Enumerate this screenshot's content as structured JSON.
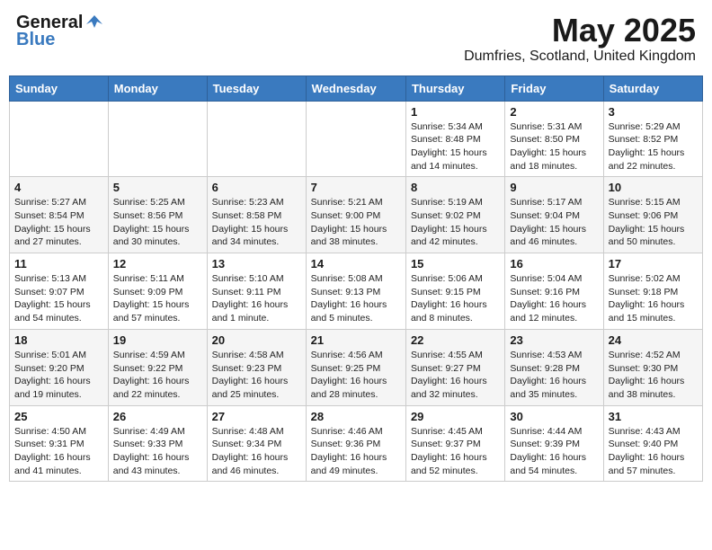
{
  "header": {
    "logo_general": "General",
    "logo_blue": "Blue",
    "month_title": "May 2025",
    "location": "Dumfries, Scotland, United Kingdom"
  },
  "weekdays": [
    "Sunday",
    "Monday",
    "Tuesday",
    "Wednesday",
    "Thursday",
    "Friday",
    "Saturday"
  ],
  "weeks": [
    [
      {
        "day": "",
        "detail": ""
      },
      {
        "day": "",
        "detail": ""
      },
      {
        "day": "",
        "detail": ""
      },
      {
        "day": "",
        "detail": ""
      },
      {
        "day": "1",
        "detail": "Sunrise: 5:34 AM\nSunset: 8:48 PM\nDaylight: 15 hours\nand 14 minutes."
      },
      {
        "day": "2",
        "detail": "Sunrise: 5:31 AM\nSunset: 8:50 PM\nDaylight: 15 hours\nand 18 minutes."
      },
      {
        "day": "3",
        "detail": "Sunrise: 5:29 AM\nSunset: 8:52 PM\nDaylight: 15 hours\nand 22 minutes."
      }
    ],
    [
      {
        "day": "4",
        "detail": "Sunrise: 5:27 AM\nSunset: 8:54 PM\nDaylight: 15 hours\nand 27 minutes."
      },
      {
        "day": "5",
        "detail": "Sunrise: 5:25 AM\nSunset: 8:56 PM\nDaylight: 15 hours\nand 30 minutes."
      },
      {
        "day": "6",
        "detail": "Sunrise: 5:23 AM\nSunset: 8:58 PM\nDaylight: 15 hours\nand 34 minutes."
      },
      {
        "day": "7",
        "detail": "Sunrise: 5:21 AM\nSunset: 9:00 PM\nDaylight: 15 hours\nand 38 minutes."
      },
      {
        "day": "8",
        "detail": "Sunrise: 5:19 AM\nSunset: 9:02 PM\nDaylight: 15 hours\nand 42 minutes."
      },
      {
        "day": "9",
        "detail": "Sunrise: 5:17 AM\nSunset: 9:04 PM\nDaylight: 15 hours\nand 46 minutes."
      },
      {
        "day": "10",
        "detail": "Sunrise: 5:15 AM\nSunset: 9:06 PM\nDaylight: 15 hours\nand 50 minutes."
      }
    ],
    [
      {
        "day": "11",
        "detail": "Sunrise: 5:13 AM\nSunset: 9:07 PM\nDaylight: 15 hours\nand 54 minutes."
      },
      {
        "day": "12",
        "detail": "Sunrise: 5:11 AM\nSunset: 9:09 PM\nDaylight: 15 hours\nand 57 minutes."
      },
      {
        "day": "13",
        "detail": "Sunrise: 5:10 AM\nSunset: 9:11 PM\nDaylight: 16 hours\nand 1 minute."
      },
      {
        "day": "14",
        "detail": "Sunrise: 5:08 AM\nSunset: 9:13 PM\nDaylight: 16 hours\nand 5 minutes."
      },
      {
        "day": "15",
        "detail": "Sunrise: 5:06 AM\nSunset: 9:15 PM\nDaylight: 16 hours\nand 8 minutes."
      },
      {
        "day": "16",
        "detail": "Sunrise: 5:04 AM\nSunset: 9:16 PM\nDaylight: 16 hours\nand 12 minutes."
      },
      {
        "day": "17",
        "detail": "Sunrise: 5:02 AM\nSunset: 9:18 PM\nDaylight: 16 hours\nand 15 minutes."
      }
    ],
    [
      {
        "day": "18",
        "detail": "Sunrise: 5:01 AM\nSunset: 9:20 PM\nDaylight: 16 hours\nand 19 minutes."
      },
      {
        "day": "19",
        "detail": "Sunrise: 4:59 AM\nSunset: 9:22 PM\nDaylight: 16 hours\nand 22 minutes."
      },
      {
        "day": "20",
        "detail": "Sunrise: 4:58 AM\nSunset: 9:23 PM\nDaylight: 16 hours\nand 25 minutes."
      },
      {
        "day": "21",
        "detail": "Sunrise: 4:56 AM\nSunset: 9:25 PM\nDaylight: 16 hours\nand 28 minutes."
      },
      {
        "day": "22",
        "detail": "Sunrise: 4:55 AM\nSunset: 9:27 PM\nDaylight: 16 hours\nand 32 minutes."
      },
      {
        "day": "23",
        "detail": "Sunrise: 4:53 AM\nSunset: 9:28 PM\nDaylight: 16 hours\nand 35 minutes."
      },
      {
        "day": "24",
        "detail": "Sunrise: 4:52 AM\nSunset: 9:30 PM\nDaylight: 16 hours\nand 38 minutes."
      }
    ],
    [
      {
        "day": "25",
        "detail": "Sunrise: 4:50 AM\nSunset: 9:31 PM\nDaylight: 16 hours\nand 41 minutes."
      },
      {
        "day": "26",
        "detail": "Sunrise: 4:49 AM\nSunset: 9:33 PM\nDaylight: 16 hours\nand 43 minutes."
      },
      {
        "day": "27",
        "detail": "Sunrise: 4:48 AM\nSunset: 9:34 PM\nDaylight: 16 hours\nand 46 minutes."
      },
      {
        "day": "28",
        "detail": "Sunrise: 4:46 AM\nSunset: 9:36 PM\nDaylight: 16 hours\nand 49 minutes."
      },
      {
        "day": "29",
        "detail": "Sunrise: 4:45 AM\nSunset: 9:37 PM\nDaylight: 16 hours\nand 52 minutes."
      },
      {
        "day": "30",
        "detail": "Sunrise: 4:44 AM\nSunset: 9:39 PM\nDaylight: 16 hours\nand 54 minutes."
      },
      {
        "day": "31",
        "detail": "Sunrise: 4:43 AM\nSunset: 9:40 PM\nDaylight: 16 hours\nand 57 minutes."
      }
    ]
  ]
}
